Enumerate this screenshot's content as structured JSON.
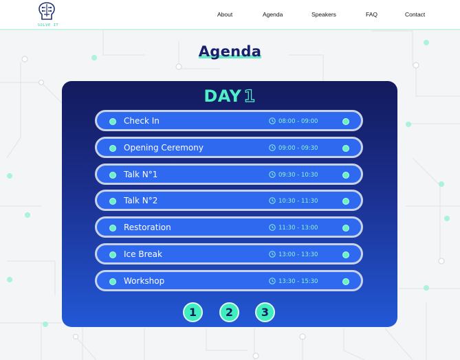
{
  "header": {
    "logo_text": "SOLVE IT",
    "nav": [
      "About",
      "Agenda",
      "Speakers",
      "FAQ",
      "Contact"
    ]
  },
  "title": "Agenda",
  "day": {
    "label": "DAY",
    "number": "1"
  },
  "agenda": [
    {
      "label": "Check In",
      "time": "08:00 - 09:00"
    },
    {
      "label": "Opening Ceremony",
      "time": "09:00 - 09:30"
    },
    {
      "label": "Talk N°1",
      "time": "09:30 - 10:30"
    },
    {
      "label": "Talk N°2",
      "time": "10:30 - 11:30"
    },
    {
      "label": "Restoration",
      "time": "11:30 - 13:00"
    },
    {
      "label": "Ice Break",
      "time": "13:00 - 13:30"
    },
    {
      "label": "Workshop",
      "time": "13:30 - 15:30"
    }
  ],
  "pager": [
    "1",
    "2",
    "3"
  ],
  "colors": {
    "accent": "#4ff0c8",
    "navy": "#16206b",
    "row_blue": "#2e69f0"
  }
}
